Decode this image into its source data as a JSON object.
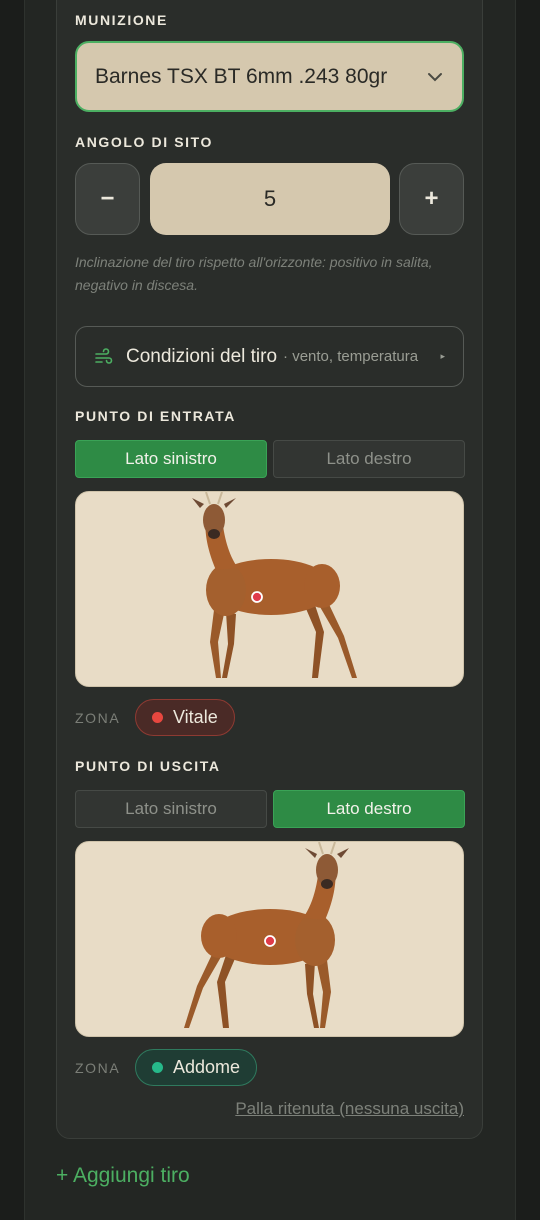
{
  "munizione": {
    "label": "MUNIZIONE",
    "selected": "Barnes TSX BT 6mm .243 80gr"
  },
  "angolo": {
    "label": "ANGOLO DI SITO",
    "minus": "−",
    "plus": "+",
    "value": "5",
    "hint": "Inclinazione del tiro rispetto all'orizzonte: positivo in salita, negativo in discesa."
  },
  "condizioni": {
    "title": "Condizioni del tiro",
    "subtitle": "· vento, temperatura",
    "arrow": "▸"
  },
  "entrata": {
    "label": "PUNTO DI ENTRATA",
    "left": "Lato sinistro",
    "right": "Lato destro",
    "active": "left",
    "zone_label": "ZONA",
    "zone": "Vitale",
    "zone_color": "#e8473f"
  },
  "uscita": {
    "label": "PUNTO DI USCITA",
    "left": "Lato sinistro",
    "right": "Lato destro",
    "active": "right",
    "zone_label": "ZONA",
    "zone": "Addome",
    "zone_color": "#26b98a"
  },
  "palla_ritenuta": "Palla ritenuta (nessuna uscita)",
  "aggiungi": "+ Aggiungi tiro"
}
